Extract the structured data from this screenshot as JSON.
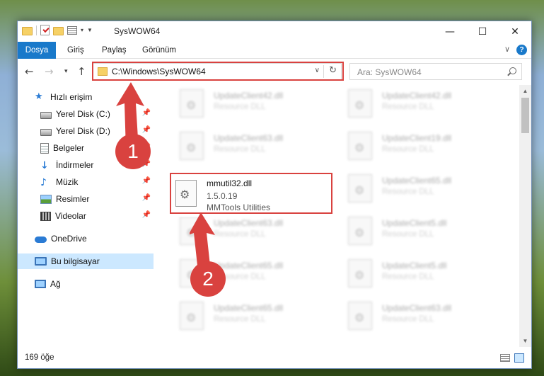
{
  "window": {
    "title": "SysWOW64"
  },
  "title_controls": {
    "minimize": "—",
    "maximize": "☐",
    "close": "✕"
  },
  "ribbon": {
    "file_tab": "Dosya",
    "tabs": [
      "Giriş",
      "Paylaş",
      "Görünüm"
    ],
    "help": "?"
  },
  "address": {
    "path": "C:\\Windows\\SysWOW64",
    "refresh": "↻"
  },
  "search": {
    "placeholder": "Ara: SysWOW64"
  },
  "sidebar": {
    "items": [
      {
        "label": "Hızlı erişim",
        "icon": "star-icon"
      },
      {
        "label": "Yerel Disk (C:)",
        "icon": "disk-icon",
        "pinned": true
      },
      {
        "label": "Yerel Disk (D:)",
        "icon": "disk-icon",
        "pinned": true
      },
      {
        "label": "Belgeler",
        "icon": "documents-icon",
        "pinned": true
      },
      {
        "label": "İndirmeler",
        "icon": "downloads-icon",
        "pinned": true
      },
      {
        "label": "Müzik",
        "icon": "music-icon",
        "pinned": true
      },
      {
        "label": "Resimler",
        "icon": "pictures-icon",
        "pinned": true
      },
      {
        "label": "Videolar",
        "icon": "videos-icon",
        "pinned": true
      },
      {
        "label": "OneDrive",
        "icon": "onedrive-icon"
      },
      {
        "label": "Bu bilgisayar",
        "icon": "computer-icon",
        "selected": true
      },
      {
        "label": "Ağ",
        "icon": "network-icon"
      }
    ]
  },
  "files": [
    {
      "name": "UpdateClient42.dll",
      "type": "Resource DLL"
    },
    {
      "name": "UpdateClient42.dll",
      "type": "Resource DLL"
    },
    {
      "name": "UpdateClient63.dll",
      "type": "Resource DLL"
    },
    {
      "name": "UpdateClient19.dll",
      "type": "Resource DLL"
    },
    {
      "name": "UpdateClient65.dll",
      "type": "Resource DLL"
    },
    {
      "name": "UpdateClient63.dll",
      "type": "Resource DLL"
    },
    {
      "name": "UpdateClient5.dll",
      "type": "Resource DLL"
    },
    {
      "name": "UpdateClient65.dll",
      "type": "Resource DLL"
    },
    {
      "name": "UpdateClient5.dll",
      "type": "Resource DLL"
    },
    {
      "name": "UpdateClient65.dll",
      "type": "Resource DLL"
    },
    {
      "name": "UpdateClient63.dll",
      "type": "Resource DLL"
    }
  ],
  "focused_file": {
    "name": "mmutil32.dll",
    "version": "1.5.0.19",
    "company": "MMTools Utilities"
  },
  "status": {
    "item_count": "169 öğe"
  },
  "annotations": {
    "step1": "1",
    "step2": "2",
    "color": "#d9423f"
  }
}
